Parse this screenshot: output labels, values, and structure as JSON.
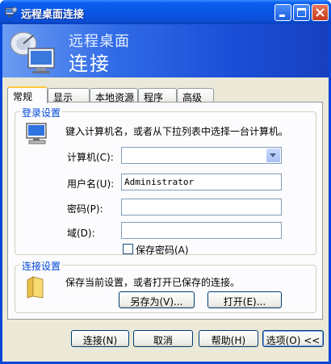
{
  "window": {
    "title": "远程桌面连接"
  },
  "banner": {
    "line1": "远程桌面",
    "line2": "连接"
  },
  "tabs": [
    {
      "label": "常规",
      "active": true
    },
    {
      "label": "显示",
      "active": false
    },
    {
      "label": "本地资源",
      "active": false
    },
    {
      "label": "程序",
      "active": false
    },
    {
      "label": "高级",
      "active": false
    }
  ],
  "login": {
    "legend": "登录设置",
    "description": "键入计算机名，或者从下拉列表中选择一台计算机。",
    "computer_label": "计算机(C):",
    "computer_value": "",
    "username_label": "用户名(U):",
    "username_value": "Administrator",
    "password_label": "密码(P):",
    "password_value": "",
    "domain_label": "域(D):",
    "domain_value": "",
    "save_password_label": "保存密码(A)",
    "save_password_checked": false
  },
  "connection": {
    "legend": "连接设置",
    "description": "保存当前设置，或者打开已保存的连接。",
    "save_as_label": "另存为(V)...",
    "open_label": "打开(E)..."
  },
  "footer": {
    "connect_label": "连接(N)",
    "cancel_label": "取消",
    "help_label": "帮助(H)",
    "options_label": "选项(O) <<"
  }
}
